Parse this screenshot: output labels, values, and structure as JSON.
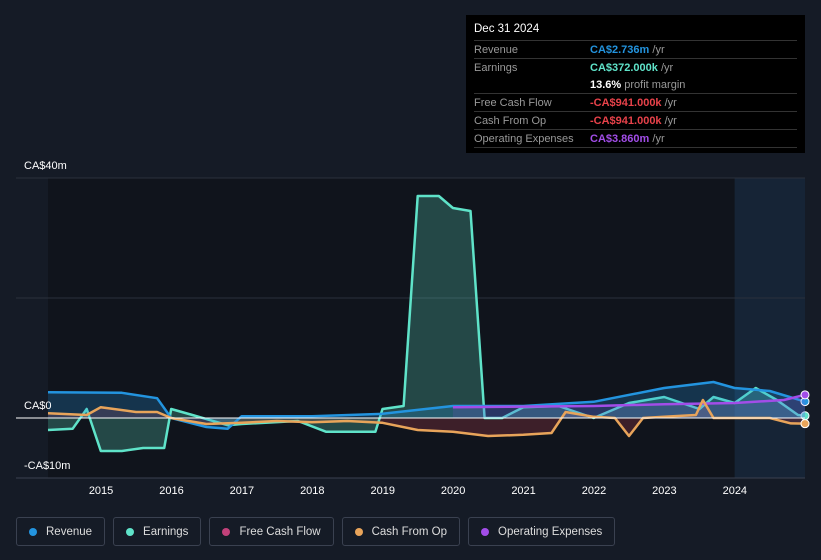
{
  "tooltip": {
    "date": "Dec 31 2024",
    "rows": [
      {
        "label": "Revenue",
        "value": "CA$2.736m",
        "unit": " /yr",
        "color": "#2394df"
      },
      {
        "label": "Earnings",
        "value": "CA$372.000k",
        "unit": " /yr",
        "color": "#5fe3c9"
      },
      {
        "label": "",
        "value": "13.6%",
        "unit": " profit margin",
        "color": "#ffffff"
      },
      {
        "label": "Free Cash Flow",
        "value": "-CA$941.000k",
        "unit": " /yr",
        "color": "#e8424a"
      },
      {
        "label": "Cash From Op",
        "value": "-CA$941.000k",
        "unit": " /yr",
        "color": "#e8424a"
      },
      {
        "label": "Operating Expenses",
        "value": "CA$3.860m",
        "unit": " /yr",
        "color": "#a24de8"
      }
    ]
  },
  "legend": [
    {
      "label": "Revenue",
      "color": "#2394df"
    },
    {
      "label": "Earnings",
      "color": "#5fe3c9"
    },
    {
      "label": "Free Cash Flow",
      "color": "#c2417a"
    },
    {
      "label": "Cash From Op",
      "color": "#e8a45a"
    },
    {
      "label": "Operating Expenses",
      "color": "#a24de8"
    }
  ],
  "chart_data": {
    "type": "line",
    "ylim": [
      -10,
      40
    ],
    "xlim": [
      2014.25,
      2025.0
    ],
    "y_tick_labels": [
      "CA$40m",
      "CA$0",
      "-CA$10m"
    ],
    "x_tick_labels": [
      "2015",
      "2016",
      "2017",
      "2018",
      "2019",
      "2020",
      "2021",
      "2022",
      "2023",
      "2024"
    ],
    "grid": true,
    "legend_position": "bottom",
    "forecast_shading_from": 2024,
    "series": [
      {
        "name": "Revenue",
        "color": "#2394df",
        "points": [
          [
            2014.25,
            4.3
          ],
          [
            2015.3,
            4.2
          ],
          [
            2015.8,
            3.3
          ],
          [
            2016,
            0
          ],
          [
            2016.5,
            -1.5
          ],
          [
            2016.8,
            -1.8
          ],
          [
            2017,
            0.3
          ],
          [
            2018,
            0.3
          ],
          [
            2019,
            0.7
          ],
          [
            2020,
            2.0
          ],
          [
            2021,
            2.0
          ],
          [
            2022,
            2.7
          ],
          [
            2023,
            5.0
          ],
          [
            2023.7,
            6.0
          ],
          [
            2024,
            5.0
          ],
          [
            2024.5,
            4.5
          ],
          [
            2025,
            2.736
          ]
        ]
      },
      {
        "name": "Earnings",
        "color": "#5fe3c9",
        "points": [
          [
            2014.25,
            -2
          ],
          [
            2014.6,
            -1.8
          ],
          [
            2014.8,
            1.5
          ],
          [
            2015,
            -5.5
          ],
          [
            2015.3,
            -5.5
          ],
          [
            2015.6,
            -5
          ],
          [
            2015.9,
            -5
          ],
          [
            2016,
            1.5
          ],
          [
            2016.3,
            0.5
          ],
          [
            2016.8,
            -1.2
          ],
          [
            2017,
            -1
          ],
          [
            2017.8,
            -0.5
          ],
          [
            2018.2,
            -2.3
          ],
          [
            2018.9,
            -2.3
          ],
          [
            2019,
            1.5
          ],
          [
            2019.3,
            2
          ],
          [
            2019.5,
            37
          ],
          [
            2019.8,
            37
          ],
          [
            2020,
            35
          ],
          [
            2020.25,
            34.5
          ],
          [
            2020.45,
            0
          ],
          [
            2020.7,
            0
          ],
          [
            2021,
            1.8
          ],
          [
            2021.5,
            2
          ],
          [
            2022,
            0
          ],
          [
            2022.5,
            2.5
          ],
          [
            2023,
            3.5
          ],
          [
            2023.5,
            1.5
          ],
          [
            2023.7,
            3.5
          ],
          [
            2024,
            2.5
          ],
          [
            2024.3,
            5
          ],
          [
            2024.6,
            3
          ],
          [
            2024.9,
            0.5
          ],
          [
            2025,
            0.372
          ]
        ]
      },
      {
        "name": "Free Cash Flow",
        "color": "#c2417a",
        "points": [
          [
            2014.25,
            0.8
          ],
          [
            2014.8,
            0.5
          ],
          [
            2015,
            1.8
          ],
          [
            2015.5,
            1
          ],
          [
            2015.8,
            1
          ],
          [
            2016,
            0
          ],
          [
            2016.5,
            -1
          ],
          [
            2017,
            -0.8
          ],
          [
            2017.5,
            -0.5
          ],
          [
            2018,
            -0.7
          ],
          [
            2018.5,
            -0.5
          ],
          [
            2019,
            -0.8
          ],
          [
            2019.5,
            -2
          ],
          [
            2020,
            -2.3
          ],
          [
            2020.5,
            -3
          ],
          [
            2021,
            -2.8
          ],
          [
            2021.4,
            -2.5
          ],
          [
            2021.6,
            1
          ],
          [
            2022,
            0.2
          ],
          [
            2022.3,
            0
          ],
          [
            2022.5,
            -3
          ],
          [
            2022.7,
            0
          ],
          [
            2023,
            0.2
          ],
          [
            2023.45,
            0.5
          ],
          [
            2023.55,
            3
          ],
          [
            2023.7,
            0
          ],
          [
            2024,
            0
          ],
          [
            2024.5,
            0
          ],
          [
            2024.8,
            -0.9
          ],
          [
            2025,
            -0.941
          ]
        ]
      },
      {
        "name": "Cash From Op",
        "color": "#e8a45a",
        "points": [
          [
            2014.25,
            0.8
          ],
          [
            2014.8,
            0.5
          ],
          [
            2015,
            1.8
          ],
          [
            2015.5,
            1
          ],
          [
            2015.8,
            1
          ],
          [
            2016,
            0
          ],
          [
            2016.5,
            -1
          ],
          [
            2017,
            -0.8
          ],
          [
            2017.5,
            -0.5
          ],
          [
            2018,
            -0.7
          ],
          [
            2018.5,
            -0.5
          ],
          [
            2019,
            -0.8
          ],
          [
            2019.5,
            -2
          ],
          [
            2020,
            -2.3
          ],
          [
            2020.5,
            -3
          ],
          [
            2021,
            -2.8
          ],
          [
            2021.4,
            -2.5
          ],
          [
            2021.6,
            1
          ],
          [
            2022,
            0.2
          ],
          [
            2022.3,
            0
          ],
          [
            2022.5,
            -3
          ],
          [
            2022.7,
            0
          ],
          [
            2023,
            0.2
          ],
          [
            2023.45,
            0.5
          ],
          [
            2023.55,
            3
          ],
          [
            2023.7,
            0
          ],
          [
            2024,
            0
          ],
          [
            2024.5,
            0
          ],
          [
            2024.8,
            -0.9
          ],
          [
            2025,
            -0.941
          ]
        ]
      },
      {
        "name": "Operating Expenses",
        "color": "#a24de8",
        "points": [
          [
            2020,
            1.8
          ],
          [
            2021,
            1.9
          ],
          [
            2022,
            2.0
          ],
          [
            2023,
            2.3
          ],
          [
            2024,
            2.5
          ],
          [
            2024.7,
            3.0
          ],
          [
            2025,
            3.86
          ]
        ]
      }
    ]
  }
}
